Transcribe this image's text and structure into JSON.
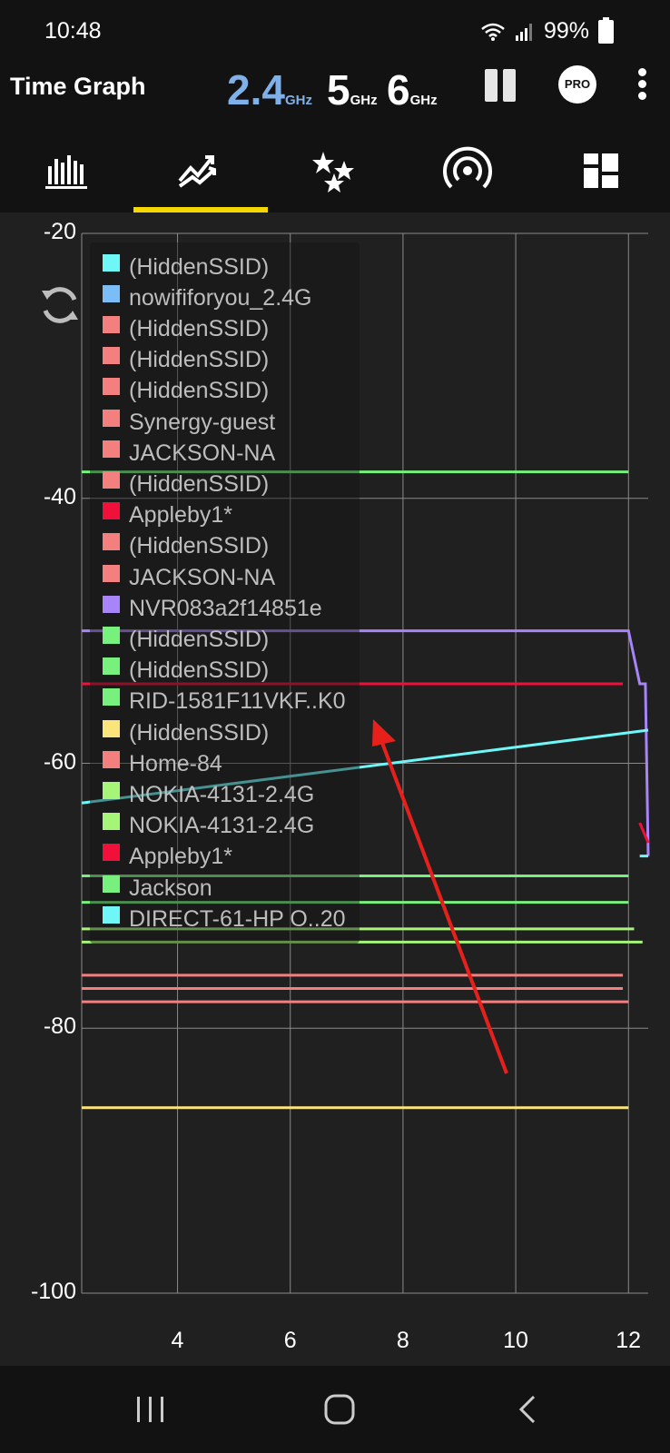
{
  "status_bar": {
    "time": "10:48",
    "battery": "99%"
  },
  "app_bar": {
    "title": "Time Graph",
    "bands": [
      {
        "num": "2.4",
        "unit": "GHz"
      },
      {
        "num": "5",
        "unit": "GHz"
      },
      {
        "num": "6",
        "unit": "GHz"
      }
    ],
    "pro_label": "PRO"
  },
  "tabs": [
    {
      "icon": "channel-graph-icon"
    },
    {
      "icon": "time-graph-icon",
      "selected": true
    },
    {
      "icon": "channel-rating-icon"
    },
    {
      "icon": "access-points-icon"
    },
    {
      "icon": "dashboard-icon"
    }
  ],
  "colors": {
    "accent": "#f5d800",
    "band_selected": "#7fb0e8",
    "background": "#202020",
    "bar": "#121212"
  },
  "legend": [
    {
      "label": "(HiddenSSID)",
      "color": "#6ff7f7"
    },
    {
      "label": "nowififoryou_2.4G",
      "color": "#7bbef7"
    },
    {
      "label": "(HiddenSSID)",
      "color": "#f47f7f"
    },
    {
      "label": "(HiddenSSID)",
      "color": "#f47f7f"
    },
    {
      "label": "(HiddenSSID)",
      "color": "#f47f7f"
    },
    {
      "label": "Synergy-guest",
      "color": "#f47f7f"
    },
    {
      "label": "JACKSON-NA",
      "color": "#f47f7f"
    },
    {
      "label": "(HiddenSSID)",
      "color": "#f47f7f"
    },
    {
      "label": "Appleby1*",
      "color": "#f0103a"
    },
    {
      "label": "(HiddenSSID)",
      "color": "#f47f7f"
    },
    {
      "label": "JACKSON-NA",
      "color": "#f47f7f"
    },
    {
      "label": "NVR083a2f14851e",
      "color": "#a784f7"
    },
    {
      "label": "(HiddenSSID)",
      "color": "#78f07e"
    },
    {
      "label": "(HiddenSSID)",
      "color": "#78f07e"
    },
    {
      "label": "RID-1581F11VKF..K0",
      "color": "#78f07e"
    },
    {
      "label": "(HiddenSSID)",
      "color": "#fbe47c"
    },
    {
      "label": "Home-84",
      "color": "#f47f7f"
    },
    {
      "label": "NOKIA-4131-2.4G",
      "color": "#a6f578"
    },
    {
      "label": "NOKIA-4131-2.4G",
      "color": "#a6f578"
    },
    {
      "label": "Appleby1*",
      "color": "#f0103a"
    },
    {
      "label": "Jackson",
      "color": "#78f07e"
    },
    {
      "label": "DIRECT-61-HP O..20",
      "color": "#6ff7f7"
    }
  ],
  "chart_data": {
    "type": "line",
    "xlabel": "",
    "ylabel": "",
    "xlim": [
      2.3,
      12.35
    ],
    "ylim": [
      -100,
      -20
    ],
    "x_ticks": [
      "4",
      "6",
      "8",
      "10",
      "12"
    ],
    "y_ticks": [
      "-20",
      "-40",
      "-60",
      "-80",
      "-100"
    ],
    "grid": true,
    "series": [
      {
        "color": "#78f07e",
        "x": [
          2.3,
          12.0
        ],
        "y": [
          -38,
          -38
        ]
      },
      {
        "color": "#a784f7",
        "x": [
          2.3,
          12.0,
          12.2,
          12.3,
          12.35
        ],
        "y": [
          -50,
          -50,
          -54,
          -54,
          -67
        ]
      },
      {
        "color": "#f0103a",
        "x": [
          2.3,
          11.9
        ],
        "y": [
          -54,
          -54
        ]
      },
      {
        "color": "#6ff7f7",
        "x": [
          2.3,
          12.35
        ],
        "y": [
          -63,
          -57.5
        ]
      },
      {
        "color": "#6ff7f7",
        "x": [
          12.2,
          12.35
        ],
        "y": [
          -67,
          -67
        ]
      },
      {
        "color": "#f0103a",
        "x": [
          12.2,
          12.35
        ],
        "y": [
          -64.5,
          -66
        ]
      },
      {
        "color": "#78f07e",
        "x": [
          2.3,
          12.0
        ],
        "y": [
          -68.5,
          -68.5
        ]
      },
      {
        "color": "#78f07e",
        "x": [
          2.3,
          12.0
        ],
        "y": [
          -70.5,
          -70.5
        ]
      },
      {
        "color": "#a6f578",
        "x": [
          2.3,
          12.1
        ],
        "y": [
          -72.5,
          -72.5
        ]
      },
      {
        "color": "#a6f578",
        "x": [
          2.3,
          12.25
        ],
        "y": [
          -73.5,
          -73.5
        ]
      },
      {
        "color": "#f47f7f",
        "x": [
          2.3,
          11.9
        ],
        "y": [
          -76,
          -76
        ]
      },
      {
        "color": "#f47f7f",
        "x": [
          2.3,
          11.9
        ],
        "y": [
          -77,
          -77
        ]
      },
      {
        "color": "#f47f7f",
        "x": [
          2.3,
          12.0
        ],
        "y": [
          -78,
          -78
        ]
      },
      {
        "color": "#fbe47c",
        "x": [
          2.3,
          12.0
        ],
        "y": [
          -86,
          -86
        ]
      }
    ]
  }
}
